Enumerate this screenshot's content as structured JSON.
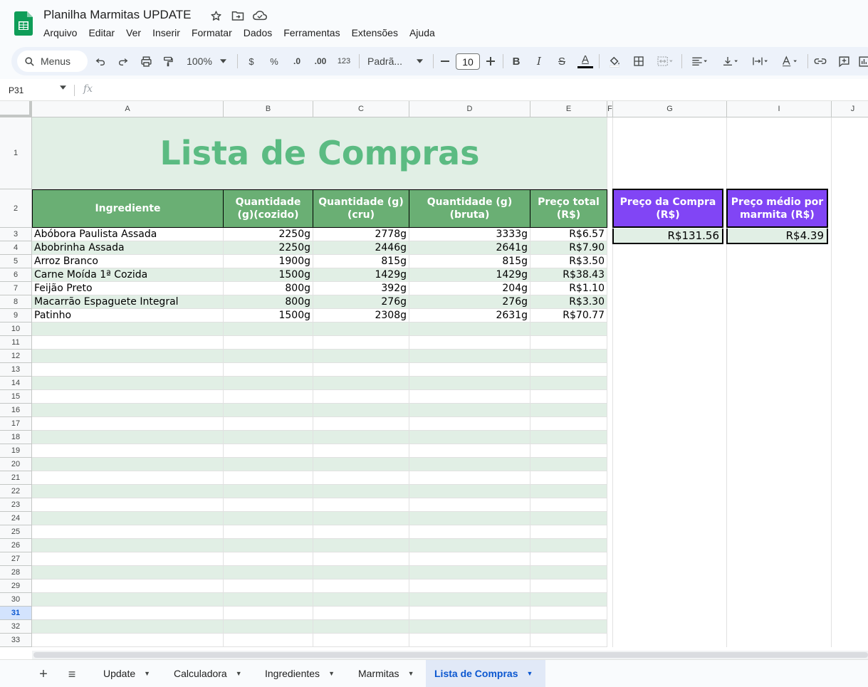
{
  "app": {
    "doc_title": "Planilha Marmitas UPDATE",
    "menus": [
      "Arquivo",
      "Editar",
      "Ver",
      "Inserir",
      "Formatar",
      "Dados",
      "Ferramentas",
      "Extensões",
      "Ajuda"
    ]
  },
  "toolbar": {
    "search_label": "Menus",
    "zoom": "100%",
    "currency": "$",
    "percent": "%",
    "dec_decrease": ".0",
    "dec_increase": ".00",
    "number_format": "123",
    "font": "Padrã...",
    "font_size": "10",
    "bold": "B",
    "italic": "I",
    "strike": "S",
    "text_color": "A"
  },
  "formula_bar": {
    "name_box": "P31",
    "fx": "fx"
  },
  "grid": {
    "columns": [
      "A",
      "B",
      "C",
      "D",
      "E",
      "F",
      "G",
      "I",
      "J"
    ],
    "rows": [
      "1",
      "2",
      "3",
      "4",
      "5",
      "6",
      "7",
      "8",
      "9",
      "10",
      "11",
      "12",
      "13",
      "14",
      "15",
      "16",
      "17",
      "18",
      "19",
      "20",
      "21",
      "22",
      "23",
      "24",
      "25",
      "26",
      "27",
      "28",
      "29",
      "30",
      "31",
      "32",
      "33"
    ],
    "selected_row": "31",
    "title": "Lista de Compras",
    "headers": [
      "Ingrediente",
      "Quantidade (g)(cozido)",
      "Quantidade (g)(cru)",
      "Quantidade (g)(bruta)",
      "Preço total (R$)"
    ],
    "items": [
      {
        "name": "Abóbora Paulista Assada",
        "cooked": "2250g",
        "raw": "2778g",
        "gross": "3333g",
        "price": "R$6.57"
      },
      {
        "name": "Abobrinha Assada",
        "cooked": "2250g",
        "raw": "2446g",
        "gross": "2641g",
        "price": "R$7.90"
      },
      {
        "name": "Arroz Branco",
        "cooked": "1900g",
        "raw": "815g",
        "gross": "815g",
        "price": "R$3.50"
      },
      {
        "name": "Carne Moída 1ª Cozida",
        "cooked": "1500g",
        "raw": "1429g",
        "gross": "1429g",
        "price": "R$38.43"
      },
      {
        "name": "Feijão Preto",
        "cooked": "800g",
        "raw": "392g",
        "gross": "204g",
        "price": "R$1.10"
      },
      {
        "name": "Macarrão Espaguete Integral",
        "cooked": "800g",
        "raw": "276g",
        "gross": "276g",
        "price": "R$3.30"
      },
      {
        "name": "Patinho",
        "cooked": "1500g",
        "raw": "2308g",
        "gross": "2631g",
        "price": "R$70.77"
      }
    ],
    "summary": {
      "purchase_label": "Preço da Compra (R$)",
      "purchase_value": "R$131.56",
      "avg_label": "Preço médio por marmita (R$)",
      "avg_value": "R$4.39"
    }
  },
  "sheets": {
    "add_label": "+",
    "list_label": "≡",
    "tabs": [
      "Update",
      "Calculadora",
      "Ingredientes",
      "Marmitas",
      "Lista de Compras"
    ],
    "active": "Lista de Compras"
  },
  "colors": {
    "header_green": "#6aaf74",
    "band_green": "#e1efe5",
    "title_green": "#5bbb82",
    "purple": "#8145f5"
  }
}
